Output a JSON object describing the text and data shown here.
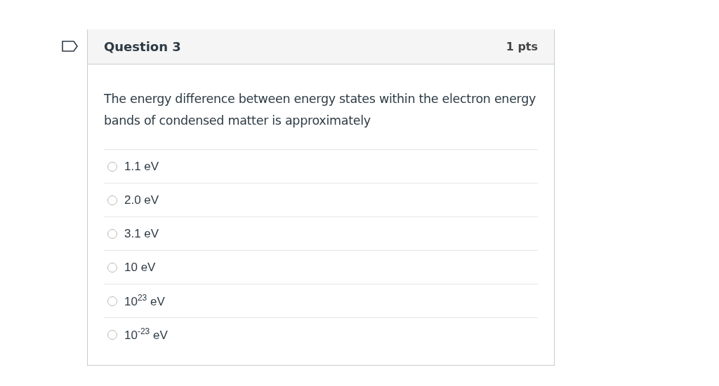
{
  "question": {
    "title": "Question 3",
    "points": "1 pts",
    "text": "The energy difference between energy states within the electron energy bands of condensed matter is approximately",
    "answers": [
      {
        "label": "1.1 eV",
        "selected": false
      },
      {
        "label": "2.0 eV",
        "selected": false
      },
      {
        "label": "3.1 eV",
        "selected": false
      },
      {
        "label": "10 eV",
        "selected": false
      },
      {
        "label": "10$^{23}$ eV",
        "selected": false
      },
      {
        "label": "10$^{-23}$ eV",
        "selected": false
      }
    ]
  }
}
